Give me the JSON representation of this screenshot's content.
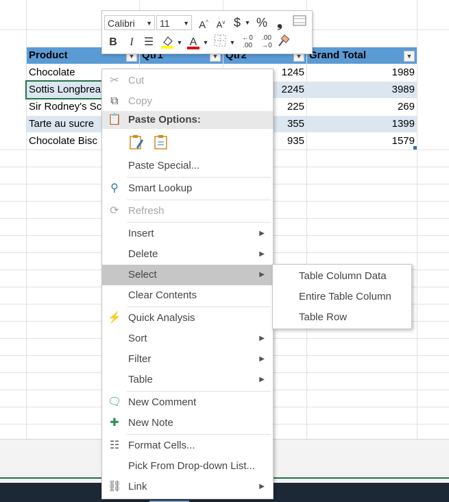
{
  "table": {
    "headers": [
      "Product",
      "Qtr1",
      "Qtr2",
      "Grand Total"
    ],
    "rows": [
      {
        "product": "Chocolate",
        "qtr2": "1245",
        "total": "1989"
      },
      {
        "product": "Sottis Longbrea",
        "qtr2": "2245",
        "total": "3989"
      },
      {
        "product": "Sir Rodney's Sc",
        "qtr2": "225",
        "total": "269"
      },
      {
        "product": "Tarte au sucre",
        "qtr2": "355",
        "total": "1399"
      },
      {
        "product": "Chocolate Bisc",
        "qtr2": "935",
        "total": "1579"
      }
    ]
  },
  "mini_toolbar": {
    "font_name": "Calibri",
    "font_size": "11",
    "currency_icon": "$",
    "percent_icon": "%",
    "bold": "B",
    "italic": "I",
    "font_color_letter": "A"
  },
  "context_menu": {
    "cut": "Cut",
    "copy": "Copy",
    "paste_options": "Paste Options:",
    "paste_special": "Paste Special...",
    "smart_lookup": "Smart Lookup",
    "refresh": "Refresh",
    "insert": "Insert",
    "delete": "Delete",
    "select": "Select",
    "clear_contents": "Clear Contents",
    "quick_analysis": "Quick Analysis",
    "sort": "Sort",
    "filter": "Filter",
    "table": "Table",
    "new_comment": "New Comment",
    "new_note": "New Note",
    "format_cells": "Format Cells...",
    "pick_list": "Pick From Drop-down List...",
    "link": "Link"
  },
  "submenu": {
    "items": [
      "Table Column Data",
      "Entire Table Column",
      "Table Row"
    ]
  },
  "colors": {
    "header_blue": "#5b9bd5",
    "band_blue": "#dce6f1",
    "selected_item": "#c6c6c6",
    "excel_green": "#217346"
  }
}
